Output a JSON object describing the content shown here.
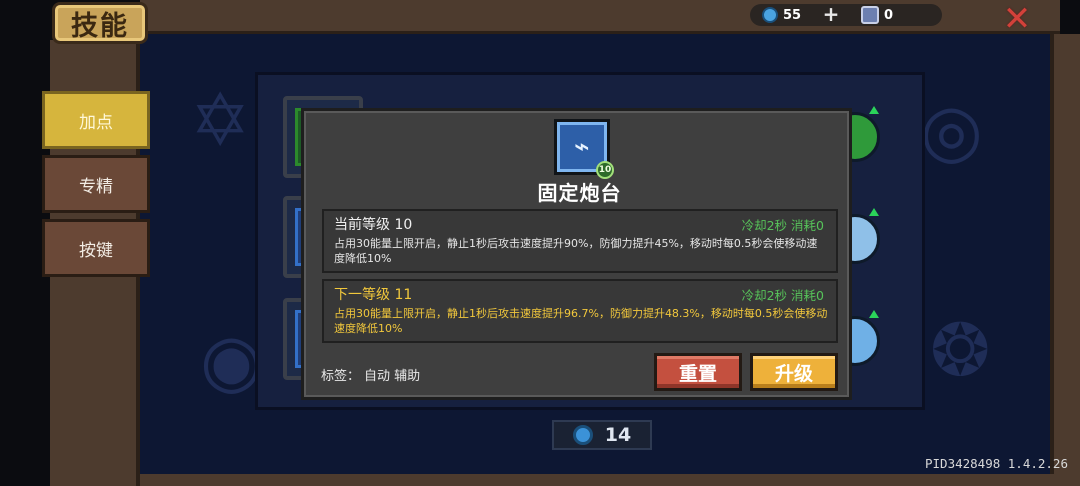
{
  "title": "技能",
  "topbar": {
    "gems": "55",
    "plus": "+",
    "materials": "0",
    "close": "✕"
  },
  "tabs": [
    {
      "label": "加点",
      "active": true
    },
    {
      "label": "专精",
      "active": false
    },
    {
      "label": "按键",
      "active": false
    }
  ],
  "skill_popup": {
    "icon_name": "turret-skill-icon",
    "level_badge": "10",
    "name": "固定炮台",
    "current": {
      "title": "当前等级 10",
      "meta": "冷却2秒 消耗0",
      "desc": "占用30能量上限开启，静止1秒后攻击速度提升90%，防御力提升45%，移动时每0.5秒会使移动速度降低10%"
    },
    "next": {
      "title": "下一等级 11",
      "meta": "冷却2秒 消耗0",
      "desc": "占用30能量上限开启，静止1秒后攻击速度提升96.7%，防御力提升48.3%，移动时每0.5秒会使移动速度降低10%"
    },
    "tags_label": "标签：",
    "tags": "自动 辅助",
    "reset_label": "重置",
    "upgrade_label": "升级"
  },
  "skill_points": "14",
  "version": "PID3428498 1.4.2.26",
  "colors": {
    "active_tab": "#d6b53d",
    "reset_button": "#c4503f",
    "upgrade_button": "#eeb13a",
    "next_level_text": "#f2c83c",
    "cooldown_text": "#57c35a"
  }
}
